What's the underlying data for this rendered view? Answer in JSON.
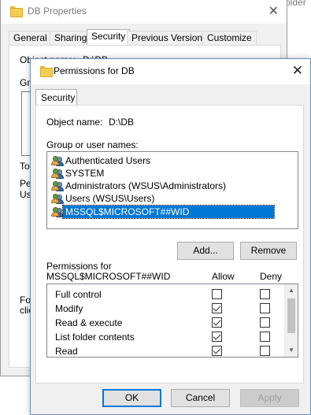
{
  "bg_window": {
    "title": "DB Properties",
    "close_glyph": "✕",
    "tabs": [
      "General",
      "Sharing",
      "Security",
      "Previous Versions",
      "Customize"
    ],
    "fragments": {
      "object_name": "Object name:",
      "object_value": "D:\\DB",
      "group": "Grou",
      "to": "To",
      "perm": "Pe",
      "us": "Us",
      "for": "For",
      "cli": "clic"
    }
  },
  "bg_right_fragment": "older",
  "dialog": {
    "title": "Permissions for DB",
    "close_glyph": "✕",
    "tab": "Security",
    "object_name_label": "Object name:",
    "object_name_value": "D:\\DB",
    "group_label": "Group or user names:",
    "users": [
      {
        "name": "Authenticated Users",
        "icon": "users-icon"
      },
      {
        "name": "SYSTEM",
        "icon": "users-icon"
      },
      {
        "name": "Administrators (WSUS\\Administrators)",
        "icon": "users-icon"
      },
      {
        "name": "Users (WSUS\\Users)",
        "icon": "users-icon"
      },
      {
        "name": "MSSQL$MICROSOFT##WID",
        "icon": "users-icon",
        "selected": true
      }
    ],
    "add_button": "Add...",
    "remove_button": "Remove",
    "permissions_label_1": "Permissions for",
    "permissions_label_2": "MSSQL$MICROSOFT##WID",
    "allow_header": "Allow",
    "deny_header": "Deny",
    "permissions": [
      {
        "name": "Full control",
        "allow": false,
        "deny": false
      },
      {
        "name": "Modify",
        "allow": true,
        "deny": false
      },
      {
        "name": "Read & execute",
        "allow": true,
        "deny": false
      },
      {
        "name": "List folder contents",
        "allow": true,
        "deny": false
      },
      {
        "name": "Read",
        "allow": true,
        "deny": false
      }
    ],
    "ok_button": "OK",
    "cancel_button": "Cancel",
    "apply_button": "Apply"
  }
}
